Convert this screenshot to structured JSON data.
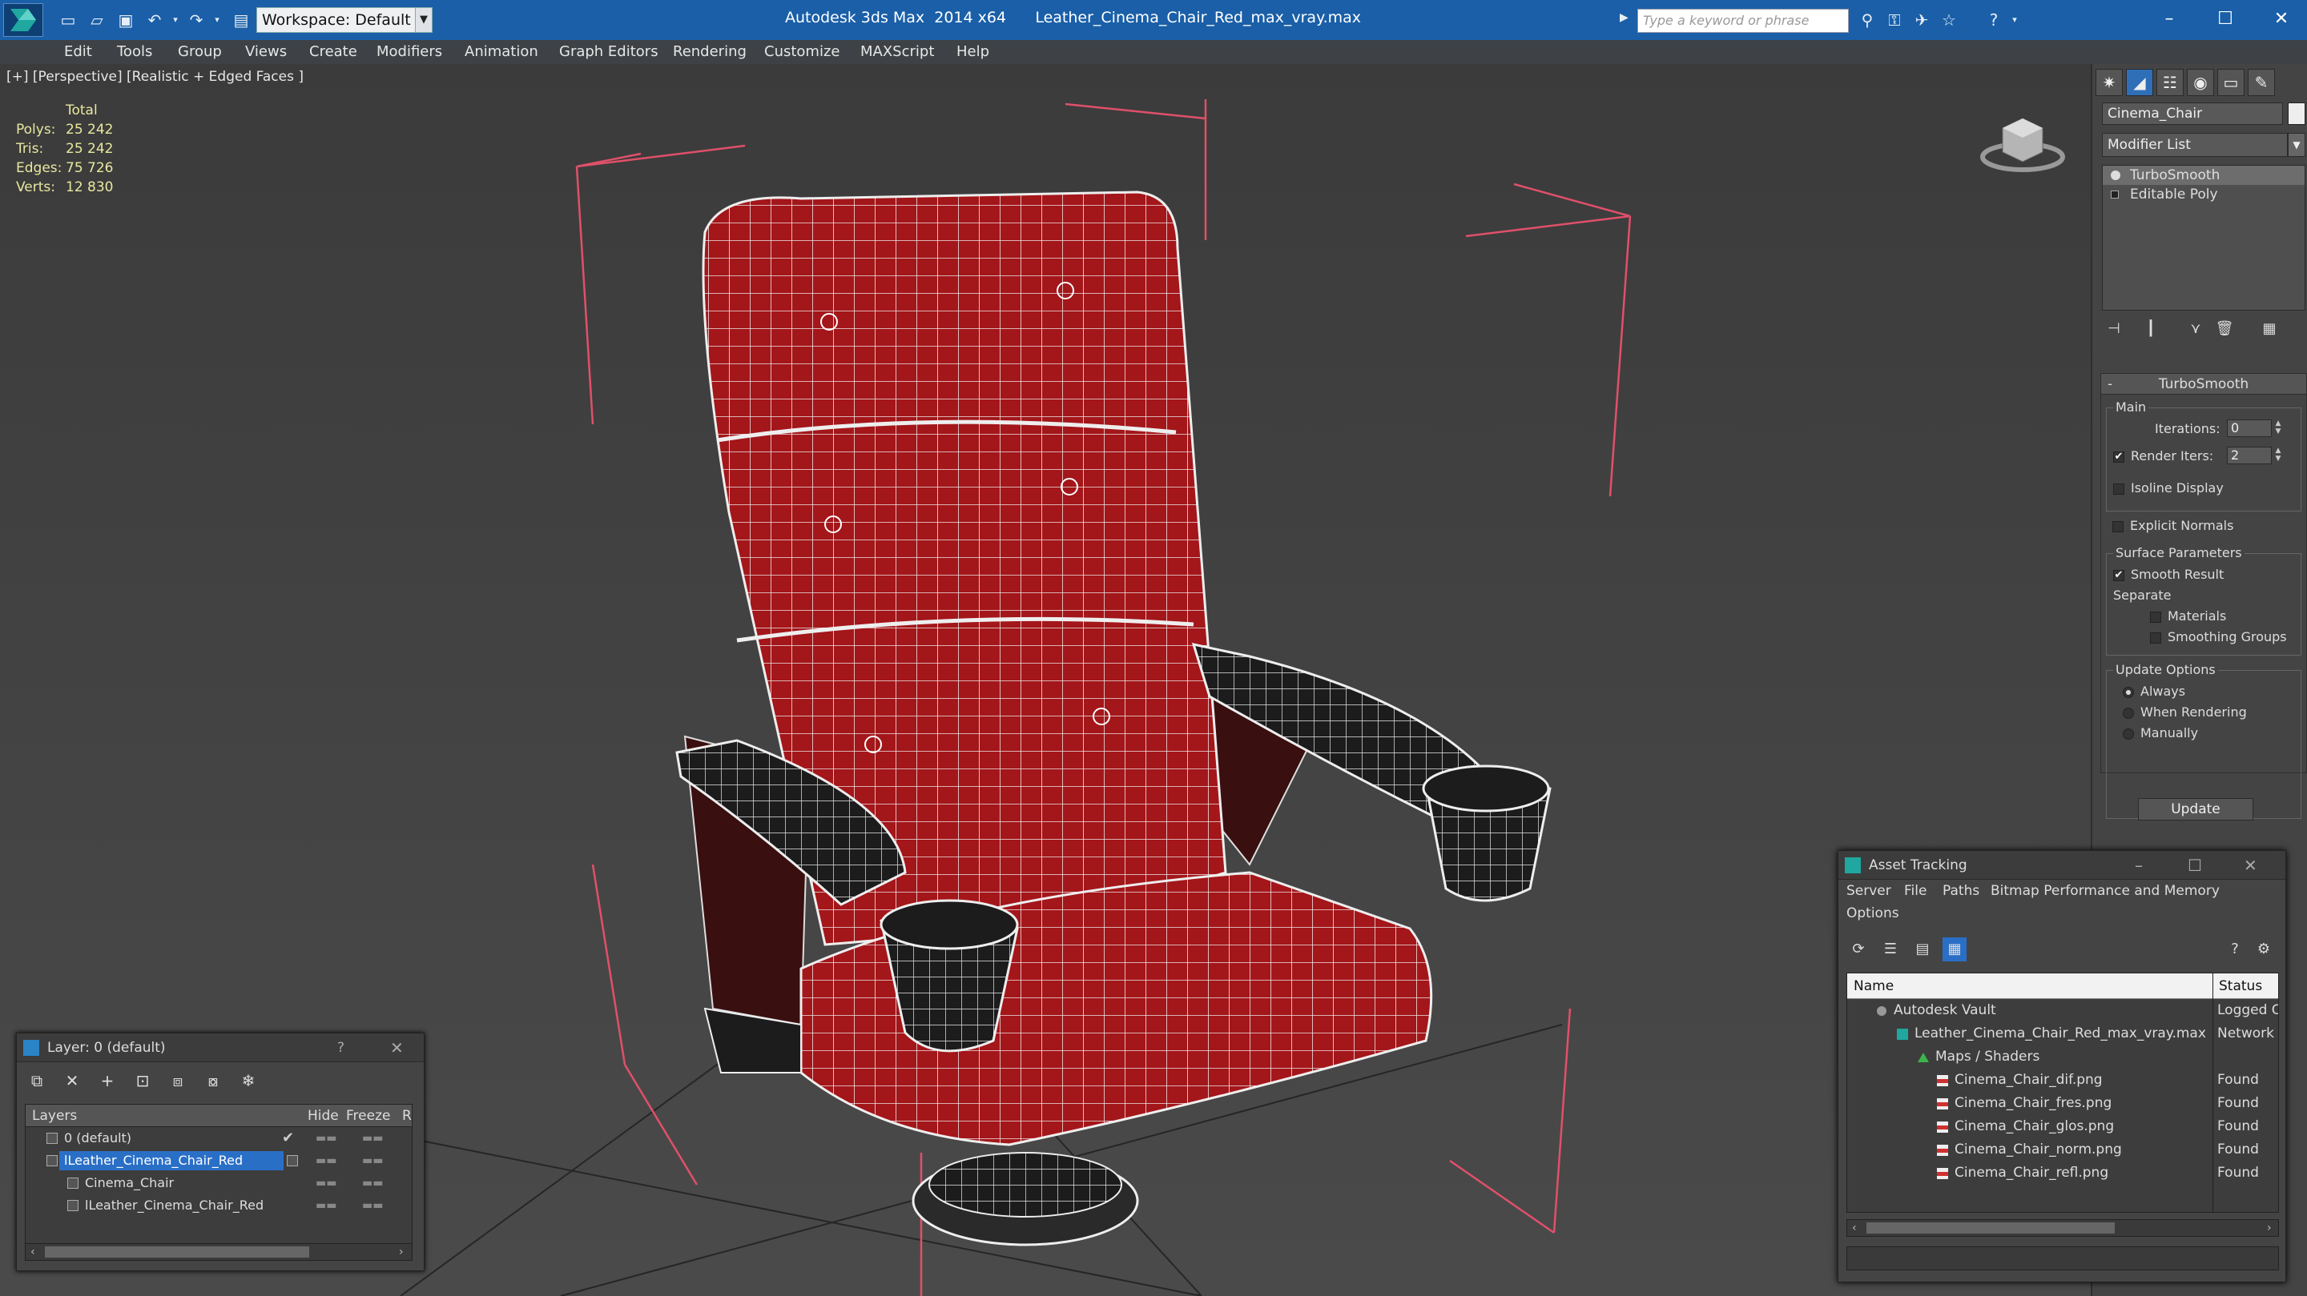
{
  "titlebar": {
    "workspace": "Workspace: Default",
    "app_title": "Autodesk 3ds Max  2014 x64",
    "file_title": "Leather_Cinema_Chair_Red_max_vray.max",
    "search_placeholder": "Type a keyword or phrase"
  },
  "menu": [
    "Edit",
    "Tools",
    "Group",
    "Views",
    "Create",
    "Modifiers",
    "Animation",
    "Graph Editors",
    "Rendering",
    "Customize",
    "MAXScript",
    "Help"
  ],
  "viewport": {
    "label": "[+] [Perspective] [Realistic + Edged Faces ]",
    "stats_header": "Total",
    "stats": [
      {
        "label": "Polys:",
        "value": "25 242"
      },
      {
        "label": "Tris:",
        "value": "25 242"
      },
      {
        "label": "Edges:",
        "value": "75 726"
      },
      {
        "label": "Verts:",
        "value": "12 830"
      }
    ],
    "wire_color": "#ffffff",
    "mesh_color": "#a3161a"
  },
  "command_panel": {
    "object_name": "Cinema_Chair",
    "modifier_list": "Modifier List",
    "stack": [
      "TurboSmooth",
      "Editable Poly"
    ],
    "rollout_title": "TurboSmooth",
    "main_group": "Main",
    "iterations_label": "Iterations:",
    "iterations_value": "0",
    "render_iters_label": "Render Iters:",
    "render_iters_value": "2",
    "isoline_display": "Isoline Display",
    "explicit_normals": "Explicit Normals",
    "surface_group": "Surface Parameters",
    "smooth_result": "Smooth Result",
    "separate_label": "Separate",
    "materials": "Materials",
    "smoothing_groups": "Smoothing Groups",
    "update_group": "Update Options",
    "always": "Always",
    "when_rendering": "When Rendering",
    "manually": "Manually",
    "update_button": "Update"
  },
  "layer_dialog": {
    "title": "Layer: 0 (default)",
    "help": "?",
    "columns": {
      "layers": "Layers",
      "hide": "Hide",
      "freeze": "Freeze",
      "r": "R"
    },
    "rows": [
      {
        "name": "0 (default)",
        "indent": 0
      },
      {
        "name": "lLeather_Cinema_Chair_Red",
        "indent": 0
      },
      {
        "name": "Cinema_Chair",
        "indent": 1
      },
      {
        "name": "lLeather_Cinema_Chair_Red",
        "indent": 1
      }
    ]
  },
  "asset_dialog": {
    "title": "Asset Tracking",
    "menu": [
      "Server",
      "File",
      "Paths",
      "Bitmap Performance and Memory",
      "Options"
    ],
    "columns": {
      "name": "Name",
      "status": "Status"
    },
    "rows": [
      {
        "name": "Autodesk Vault",
        "status": "Logged Out",
        "indent": 1
      },
      {
        "name": "Leather_Cinema_Chair_Red_max_vray.max",
        "status": "Network Path",
        "indent": 2
      },
      {
        "name": "Maps / Shaders",
        "status": "",
        "indent": 3
      },
      {
        "name": "Cinema_Chair_dif.png",
        "status": "Found",
        "indent": 4
      },
      {
        "name": "Cinema_Chair_fres.png",
        "status": "Found",
        "indent": 4
      },
      {
        "name": "Cinema_Chair_glos.png",
        "status": "Found",
        "indent": 4
      },
      {
        "name": "Cinema_Chair_norm.png",
        "status": "Found",
        "indent": 4
      },
      {
        "name": "Cinema_Chair_refl.png",
        "status": "Found",
        "indent": 4
      }
    ]
  }
}
